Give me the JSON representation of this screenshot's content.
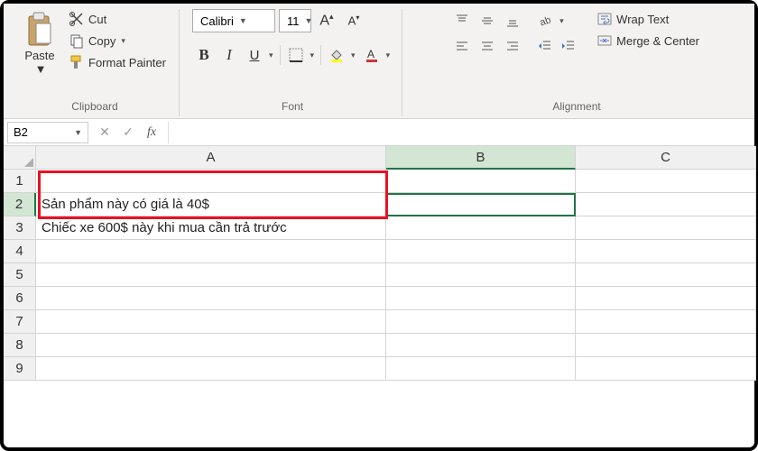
{
  "ribbon": {
    "clipboard": {
      "paste": "Paste",
      "cut": "Cut",
      "copy": "Copy",
      "format_painter": "Format Painter",
      "label": "Clipboard"
    },
    "font": {
      "name": "Calibri",
      "size": "11",
      "bold": "B",
      "italic": "I",
      "underline": "U",
      "label": "Font"
    },
    "alignment": {
      "wrap": "Wrap Text",
      "merge": "Merge & Center",
      "label": "Alignment"
    }
  },
  "formula_bar": {
    "name_box": "B2",
    "cancel": "✕",
    "enter": "✓",
    "fx": "fx",
    "value": ""
  },
  "columns": [
    "A",
    "B",
    "C"
  ],
  "rows": [
    "1",
    "2",
    "3",
    "4",
    "5",
    "6",
    "7",
    "8",
    "9"
  ],
  "cells": {
    "A2": "Sản phẩm này có giá là 40$",
    "A3": "Chiếc xe 600$ này khi mua cần trả trước"
  },
  "active_cell": "B2"
}
